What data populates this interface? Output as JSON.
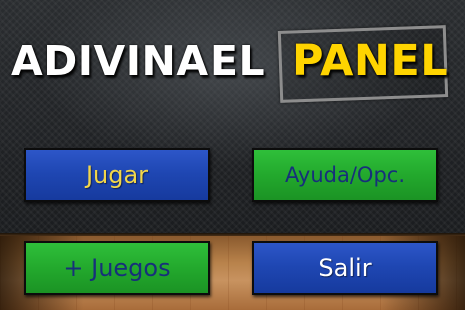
{
  "title": {
    "word1": "ADIVINA",
    "word2": "EL",
    "word3": "PANEL"
  },
  "menu": {
    "play_label": "Jugar",
    "help_label": "Ayuda/Opc.",
    "more_games_label": "+ Juegos",
    "exit_label": "Salir"
  },
  "colors": {
    "title_white": "#ffffff",
    "title_yellow": "#ffd400",
    "button_blue": "#1f47b3",
    "button_green": "#23a92d",
    "blue_button_text": "#f2d64a",
    "green_button_text": "#17307a"
  }
}
